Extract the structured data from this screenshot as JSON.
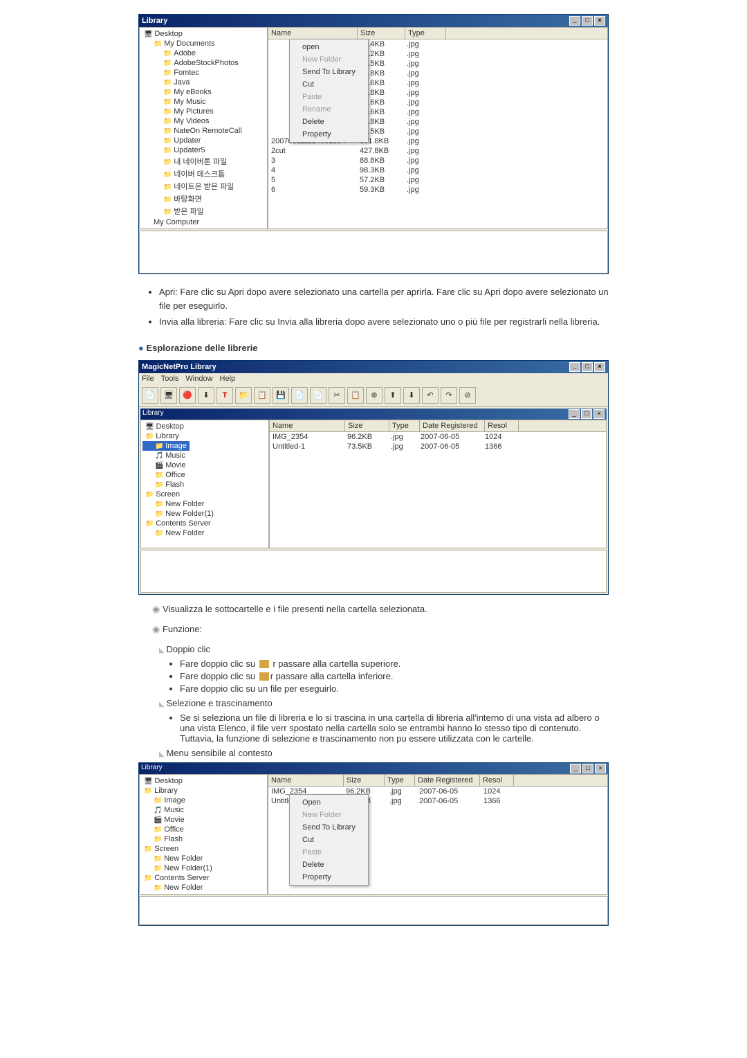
{
  "screenshot1": {
    "title": "Library",
    "tree": [
      {
        "level": 1,
        "label": "Desktop",
        "icon": "desktop"
      },
      {
        "level": 2,
        "label": "My Documents",
        "icon": "folder"
      },
      {
        "level": 3,
        "label": "Adobe",
        "icon": "folder"
      },
      {
        "level": 3,
        "label": "AdobeStockPhotos",
        "icon": "folder"
      },
      {
        "level": 3,
        "label": "Fomtec",
        "icon": "folder"
      },
      {
        "level": 3,
        "label": "Java",
        "icon": "folder"
      },
      {
        "level": 3,
        "label": "My eBooks",
        "icon": "folder"
      },
      {
        "level": 3,
        "label": "My Music",
        "icon": "folder"
      },
      {
        "level": 3,
        "label": "My Pictures",
        "icon": "folder"
      },
      {
        "level": 3,
        "label": "My Videos",
        "icon": "folder"
      },
      {
        "level": 3,
        "label": "NateOn RemoteCall",
        "icon": "folder"
      },
      {
        "level": 3,
        "label": "Updater",
        "icon": "folder"
      },
      {
        "level": 3,
        "label": "Updater5",
        "icon": "folder"
      },
      {
        "level": 3,
        "label": "내 네이버톤 파일",
        "icon": "folder"
      },
      {
        "level": 3,
        "label": "네이버 데스크톱",
        "icon": "folder"
      },
      {
        "level": 3,
        "label": "네이트온 받은 파일",
        "icon": "folder"
      },
      {
        "level": 3,
        "label": "바탕화면",
        "icon": "folder"
      },
      {
        "level": 3,
        "label": "받은 파일",
        "icon": "folder"
      },
      {
        "level": 2,
        "label": "My Computer",
        "icon": "computer"
      }
    ],
    "columns": [
      "Name",
      "Size",
      "Type"
    ],
    "rows": [
      {
        "name": "",
        "size": "85.4KB",
        "type": ".jpg"
      },
      {
        "name": "",
        "size": "36.2KB",
        "type": ".jpg"
      },
      {
        "name": "",
        "size": "39.5KB",
        "type": ".jpg"
      },
      {
        "name": "",
        "size": "48.8KB",
        "type": ".jpg"
      },
      {
        "name": "",
        "size": "45.6KB",
        "type": ".jpg"
      },
      {
        "name": "",
        "size": "38.8KB",
        "type": ".jpg"
      },
      {
        "name": "",
        "size": "46.6KB",
        "type": ".jpg"
      },
      {
        "name": "",
        "size": "41.6KB",
        "type": ".jpg"
      },
      {
        "name": "",
        "size": "42.8KB",
        "type": ".jpg"
      },
      {
        "name": "",
        "size": "83.5KB",
        "type": ".jpg"
      },
      {
        "name": "200703111124031884",
        "size": "391.8KB",
        "type": ".jpg"
      },
      {
        "name": "2cut",
        "size": "427.8KB",
        "type": ".jpg"
      },
      {
        "name": "3",
        "size": "88.8KB",
        "type": ".jpg"
      },
      {
        "name": "4",
        "size": "98.3KB",
        "type": ".jpg"
      },
      {
        "name": "5",
        "size": "57.2KB",
        "type": ".jpg"
      },
      {
        "name": "6",
        "size": "59.3KB",
        "type": ".jpg"
      }
    ],
    "context_menu": [
      "open",
      "New Folder",
      "Send To Library",
      "Cut",
      "Paste",
      "Rename",
      "Delete",
      "Property"
    ]
  },
  "bullets1": [
    "Apri: Fare clic su Apri dopo avere selezionato una cartella per aprirla. Fare clic su Apri dopo avere selezionato un file per eseguirlo.",
    "Invia alla libreria: Fare clic su Invia alla libreria dopo avere selezionato uno o più file per registrarli nella libreria."
  ],
  "heading_explore": "Esplorazione delle librerie",
  "screenshot2": {
    "app_title": "MagicNetPro Library",
    "menubar": [
      "File",
      "Tools",
      "Window",
      "Help"
    ],
    "inner_title": "Library",
    "tree": [
      {
        "level": 1,
        "label": "Desktop",
        "icon": "desktop"
      },
      {
        "level": 1,
        "label": "Library",
        "icon": "folder"
      },
      {
        "level": 2,
        "label": "Image",
        "icon": "folder",
        "selected": true
      },
      {
        "level": 2,
        "label": "Music",
        "icon": "music"
      },
      {
        "level": 2,
        "label": "Movie",
        "icon": "movie"
      },
      {
        "level": 2,
        "label": "Office",
        "icon": "folder"
      },
      {
        "level": 2,
        "label": "Flash",
        "icon": "folder"
      },
      {
        "level": 1,
        "label": "Screen",
        "icon": "folder"
      },
      {
        "level": 2,
        "label": "New Folder",
        "icon": "folder"
      },
      {
        "level": 2,
        "label": "New Folder(1)",
        "icon": "folder"
      },
      {
        "level": 1,
        "label": "Contents Server",
        "icon": "folder"
      },
      {
        "level": 2,
        "label": "New Folder",
        "icon": "folder"
      }
    ],
    "columns": [
      "Name",
      "Size",
      "Type",
      "Date Registered",
      "Resol"
    ],
    "rows": [
      {
        "name": "IMG_2354",
        "size": "96.2KB",
        "type": ".jpg",
        "date": "2007-06-05",
        "resol": "1024"
      },
      {
        "name": "Untitled-1",
        "size": "73.5KB",
        "type": ".jpg",
        "date": "2007-06-05",
        "resol": "1366"
      }
    ]
  },
  "text_visualizza": "Visualizza le sottocartelle e i file presenti nella cartella selezionata.",
  "text_funzione": "Funzione:",
  "text_doppio_clic": "Doppio clic",
  "sub_bullets_doppio": [
    "Fare doppio clic su ",
    " r passare alla cartella superiore.",
    "Fare doppio clic su ",
    "r passare alla cartella inferiore.",
    "Fare doppio clic su un file per eseguirlo."
  ],
  "text_selezione": "Selezione e trascinamento",
  "sub_bullets_selezione": [
    "Se si seleziona un file di libreria e lo si trascina in una cartella di libreria all'interno di una vista ad albero o una vista Elenco, il file verr   spostato nella cartella solo se entrambi hanno lo stesso tipo di contenuto. Tuttavia, la funzione di selezione e trascinamento non pu   essere utilizzata con le cartelle."
  ],
  "text_menu_contesto": "Menu sensibile al contesto",
  "screenshot3": {
    "title": "Library",
    "tree": [
      {
        "level": 1,
        "label": "Desktop",
        "icon": "desktop"
      },
      {
        "level": 1,
        "label": "Library",
        "icon": "folder"
      },
      {
        "level": 2,
        "label": "Image",
        "icon": "folder"
      },
      {
        "level": 2,
        "label": "Music",
        "icon": "music"
      },
      {
        "level": 2,
        "label": "Movie",
        "icon": "movie"
      },
      {
        "level": 2,
        "label": "Office",
        "icon": "folder"
      },
      {
        "level": 2,
        "label": "Flash",
        "icon": "folder"
      },
      {
        "level": 1,
        "label": "Screen",
        "icon": "folder"
      },
      {
        "level": 2,
        "label": "New Folder",
        "icon": "folder"
      },
      {
        "level": 2,
        "label": "New Folder(1)",
        "icon": "folder"
      },
      {
        "level": 1,
        "label": "Contents Server",
        "icon": "folder"
      },
      {
        "level": 2,
        "label": "New Folder",
        "icon": "folder"
      }
    ],
    "columns": [
      "Name",
      "Size",
      "Type",
      "Date Registered",
      "Resol"
    ],
    "rows": [
      {
        "name": "IMG_2354",
        "size": "96.2KB",
        "type": ".jpg",
        "date": "2007-06-05",
        "resol": "1024"
      },
      {
        "name": "Untitled-1",
        "size": "73.5KB",
        "type": ".jpg",
        "date": "2007-06-05",
        "resol": "1366"
      }
    ],
    "context_menu": [
      "Open",
      "New Folder",
      "Send To Library",
      "Cut",
      "Paste",
      "Delete",
      "Property"
    ]
  }
}
